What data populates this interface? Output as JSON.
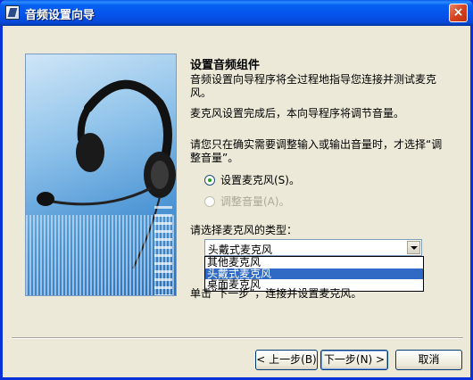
{
  "window": {
    "title": "音频设置向导",
    "close_glyph": "×"
  },
  "page": {
    "heading": "设置音频组件",
    "intro": "音频设置向导程序将全过程地指导您连接并测试麦克风。",
    "after_setup": "麦克风设置完成后，本向导程序将调节音量。",
    "volume_hint": "请您只在确实需要调整输入或输出音量时，才选择“调整音量”。"
  },
  "options": [
    {
      "label": "设置麦克风(S)。",
      "checked": true,
      "enabled": true
    },
    {
      "label": "调整音量(A)。",
      "checked": false,
      "enabled": false
    }
  ],
  "mic_type": {
    "label": "请选择麦克风的类型：",
    "selected": "头戴式麦克风",
    "items": [
      "其他麦克风",
      "头戴式麦克风",
      "桌面麦克风"
    ],
    "highlighted_index": 1
  },
  "footer_text": "单击“下一步”，连接并设置麦克风。",
  "buttons": {
    "back": "< 上一步(B)",
    "next": "下一步(N) >",
    "cancel": "取消"
  },
  "icons": [
    "app-icon",
    "close-icon",
    "headset-illustration",
    "dropdown-arrow-icon"
  ]
}
